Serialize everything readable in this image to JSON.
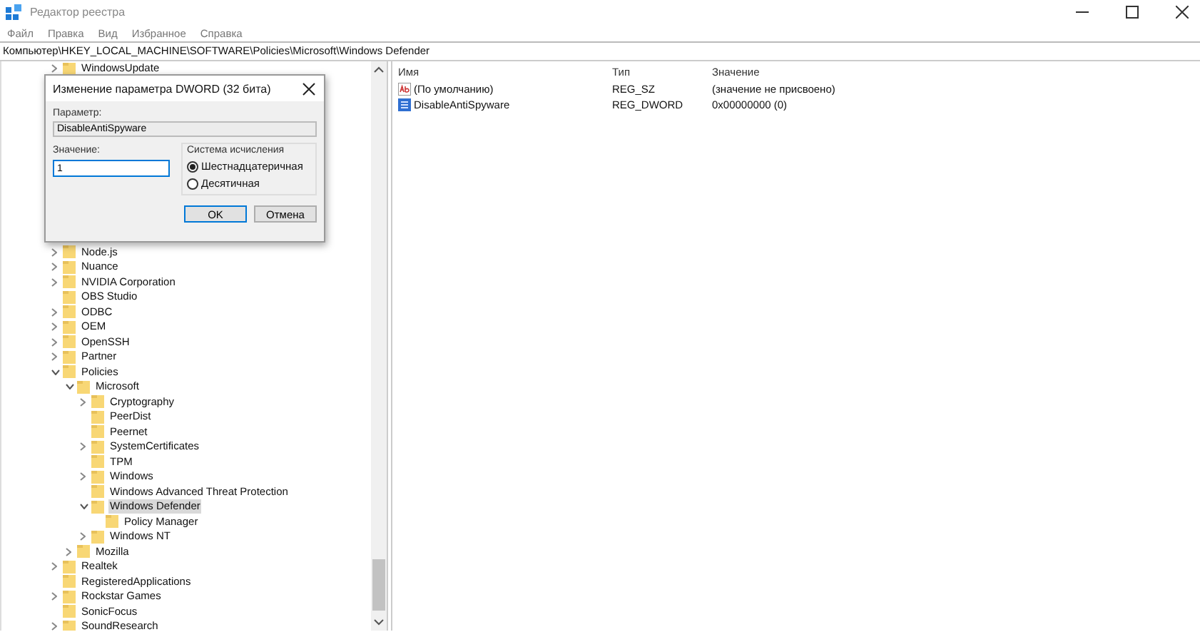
{
  "window": {
    "title": "Редактор реестра"
  },
  "menu": [
    "Файл",
    "Правка",
    "Вид",
    "Избранное",
    "Справка"
  ],
  "address_bar": {
    "value": "Компьютер\\HKEY_LOCAL_MACHINE\\SOFTWARE\\Policies\\Microsoft\\Windows Defender"
  },
  "tree": [
    {
      "label": "WindowsUpdate",
      "has_children": true,
      "expanded": false,
      "selected": false
    },
    {
      "label": "Node.js",
      "has_children": true,
      "expanded": false,
      "selected": false
    },
    {
      "label": "Nuance",
      "has_children": true,
      "expanded": false,
      "selected": false
    },
    {
      "label": "NVIDIA Corporation",
      "has_children": true,
      "expanded": false,
      "selected": false
    },
    {
      "label": "OBS Studio",
      "has_children": false,
      "selected": false
    },
    {
      "label": "ODBC",
      "has_children": true,
      "expanded": false,
      "selected": false
    },
    {
      "label": "OEM",
      "has_children": true,
      "expanded": false,
      "selected": false
    },
    {
      "label": "OpenSSH",
      "has_children": true,
      "expanded": false,
      "selected": false
    },
    {
      "label": "Partner",
      "has_children": true,
      "expanded": false,
      "selected": false
    },
    {
      "label": "Policies",
      "has_children": true,
      "expanded": true,
      "selected": false,
      "children": [
        {
          "label": "Microsoft",
          "has_children": true,
          "expanded": true,
          "selected": false,
          "children": [
            {
              "label": "Cryptography",
              "has_children": true,
              "expanded": false,
              "selected": false
            },
            {
              "label": "PeerDist",
              "has_children": false,
              "selected": false
            },
            {
              "label": "Peernet",
              "has_children": false,
              "selected": false
            },
            {
              "label": "SystemCertificates",
              "has_children": true,
              "expanded": false,
              "selected": false
            },
            {
              "label": "TPM",
              "has_children": false,
              "selected": false
            },
            {
              "label": "Windows",
              "has_children": true,
              "expanded": false,
              "selected": false
            },
            {
              "label": "Windows Advanced Threat Protection",
              "has_children": false,
              "selected": false
            },
            {
              "label": "Windows Defender",
              "has_children": true,
              "expanded": true,
              "selected": true,
              "children": [
                {
                  "label": "Policy Manager",
                  "has_children": false,
                  "selected": false
                }
              ]
            },
            {
              "label": "Windows NT",
              "has_children": true,
              "expanded": false,
              "selected": false
            }
          ]
        },
        {
          "label": "Mozilla",
          "has_children": true,
          "expanded": false,
          "selected": false
        }
      ]
    },
    {
      "label": "Realtek",
      "has_children": true,
      "expanded": false,
      "selected": false
    },
    {
      "label": "RegisteredApplications",
      "has_children": false,
      "selected": false
    },
    {
      "label": "Rockstar Games",
      "has_children": true,
      "expanded": false,
      "selected": false
    },
    {
      "label": "SonicFocus",
      "has_children": false,
      "selected": false
    },
    {
      "label": "SoundResearch",
      "has_children": true,
      "expanded": false,
      "selected": false
    }
  ],
  "values_table": {
    "columns": [
      "Имя",
      "Тип",
      "Значение"
    ],
    "rows": [
      {
        "kind": "string",
        "name": "(По умолчанию)",
        "type": "REG_SZ",
        "data": "(значение не присвоено)"
      },
      {
        "kind": "binary",
        "name": "DisableAntiSpyware",
        "type": "REG_DWORD",
        "data": "0x00000000 (0)"
      }
    ]
  },
  "dialog": {
    "title": "Изменение параметра DWORD (32 бита)",
    "parameter_label": "Параметр:",
    "parameter_value": "DisableAntiSpyware",
    "value_label": "Значение:",
    "value": "1",
    "base_group": {
      "title": "Система исчисления",
      "options": [
        {
          "label": "Шестнадцатеричная",
          "selected": true
        },
        {
          "label": "Десятичная",
          "selected": false
        }
      ]
    },
    "buttons": [
      {
        "label": "OK",
        "default": true
      },
      {
        "label": "Отмена",
        "default": false
      }
    ]
  }
}
